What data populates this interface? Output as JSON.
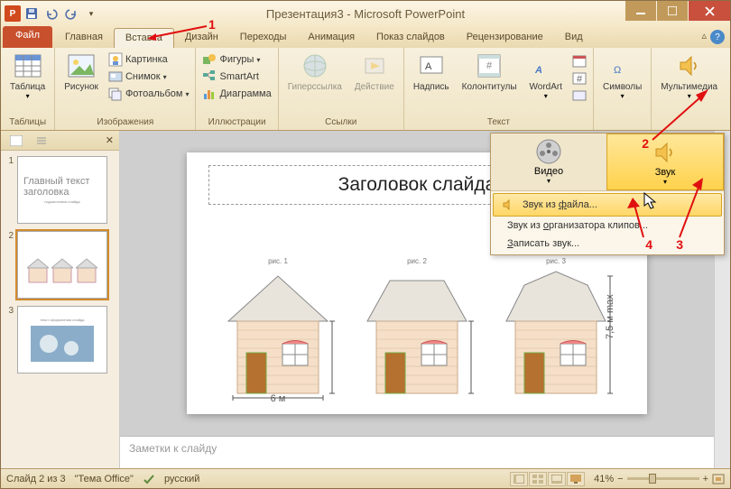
{
  "title": "Презентация3 - Microsoft PowerPoint",
  "app_letter": "P",
  "tabs": {
    "file": "Файл",
    "home": "Главная",
    "insert": "Вставка",
    "design": "Дизайн",
    "transitions": "Переходы",
    "animations": "Анимация",
    "slideshow": "Показ слайдов",
    "review": "Рецензирование",
    "view": "Вид"
  },
  "ribbon": {
    "tables": {
      "table": "Таблица",
      "group": "Таблицы"
    },
    "images": {
      "picture": "Рисунок",
      "clipart": "Картинка",
      "screenshot": "Снимок",
      "album": "Фотоальбом",
      "group": "Изображения"
    },
    "illus": {
      "shapes": "Фигуры",
      "smartart": "SmartArt",
      "chart": "Диаграмма",
      "group": "Иллюстрации"
    },
    "links": {
      "hyperlink": "Гиперссылка",
      "action": "Действие",
      "group": "Ссылки"
    },
    "text": {
      "textbox": "Надпись",
      "headerfooter": "Колонтитулы",
      "wordart": "WordArt",
      "group": "Текст"
    },
    "symbols": {
      "symbols": "Символы",
      "group": ""
    },
    "media": {
      "media": "Мультимедиа",
      "video": "Видео",
      "audio": "Звук"
    }
  },
  "media_menu": {
    "from_file": "Звук из файла...",
    "from_organizer": "Звук из организатора клипов...",
    "record": "Записать звук...",
    "underline": {
      "from_file": "ф",
      "from_organizer": "о",
      "record": "З"
    }
  },
  "thumbs_tabs": {
    "slides": "",
    "outline": ""
  },
  "slide": {
    "title": "Заголовок слайда",
    "pic_labels": [
      "рис. 1",
      "рис. 2",
      "рис. 3"
    ]
  },
  "notes": "Заметки к слайду",
  "status": {
    "slide": "Слайд 2 из 3",
    "theme": "\"Тема Office\"",
    "lang": "русский",
    "zoom": "41%"
  },
  "ann": {
    "n1": "1",
    "n2": "2",
    "n3": "3",
    "n4": "4"
  }
}
